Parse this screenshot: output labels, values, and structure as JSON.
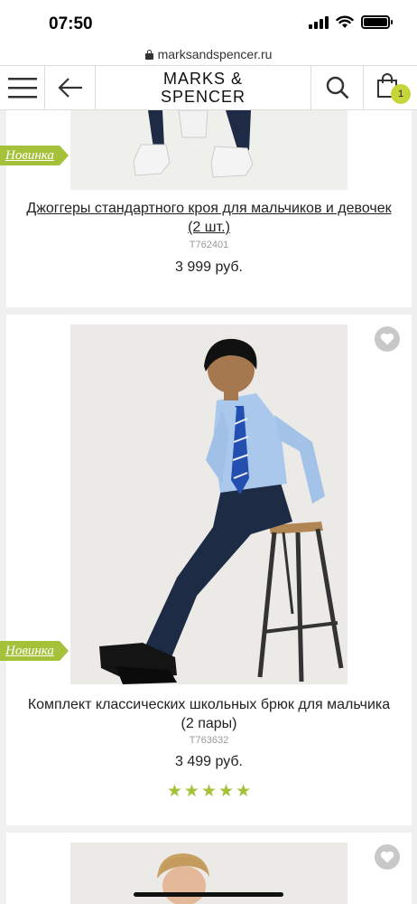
{
  "status": {
    "time": "07:50"
  },
  "browser": {
    "url": "marksandspencer.ru"
  },
  "header": {
    "logo_line1": "MARKS &",
    "logo_line2": "SPENCER",
    "bag_count": "1",
    "accent_color": "#c5d53a"
  },
  "products": [
    {
      "badge": "Новинка",
      "title": "Джоггеры стандартного кроя для мальчиков и девочек (2 шт.)",
      "code": "T762401",
      "price": "3 999 руб."
    },
    {
      "badge": "Новинка",
      "title": "Комплект классических школьных брюк для мальчика (2 пары)",
      "code": "T763632",
      "price": "3 499 руб.",
      "rating": 5,
      "max_rating": 5
    },
    {}
  ],
  "icons": [
    "hamburger-menu-icon",
    "back-arrow-icon",
    "search-icon",
    "shopping-bag-icon",
    "heart-icon",
    "star-icon",
    "lock-icon",
    "signal-icon",
    "wifi-icon",
    "battery-icon"
  ],
  "colors": {
    "badge_green": "#a5c13a",
    "background": "#f0f0f0"
  }
}
